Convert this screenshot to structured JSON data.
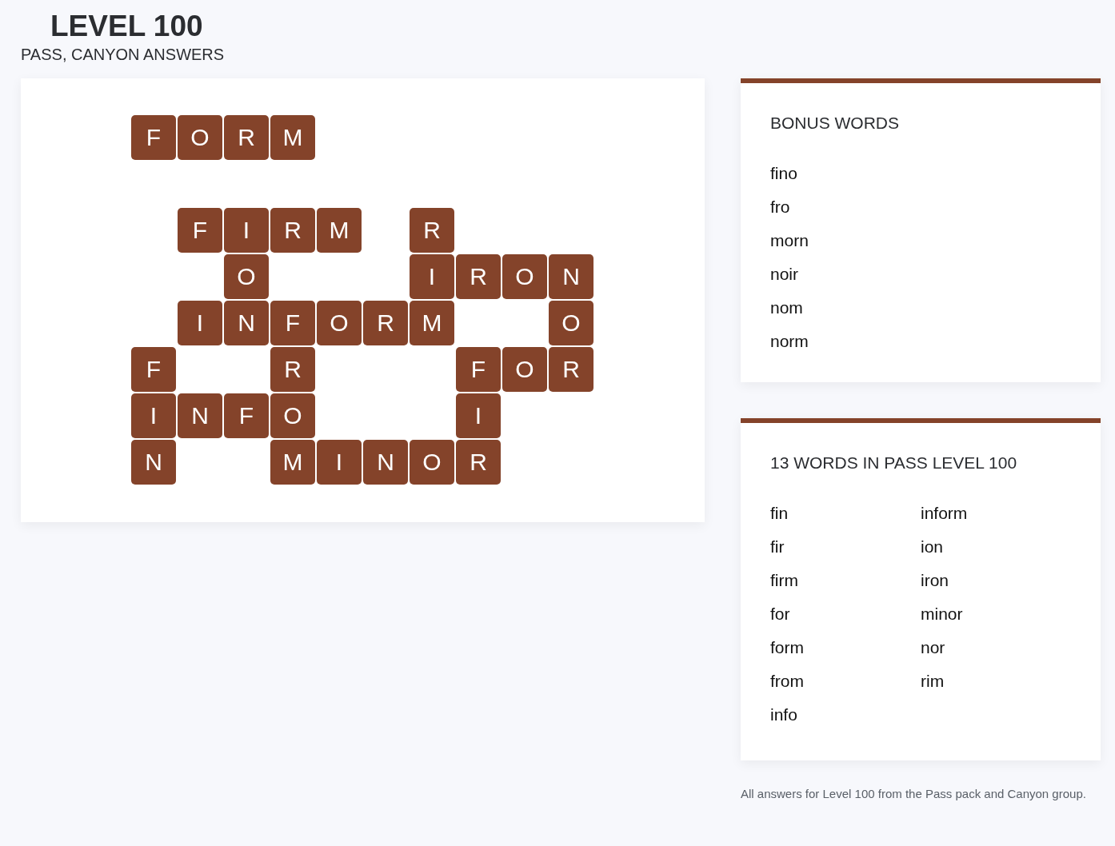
{
  "header": {
    "title": "LEVEL 100",
    "subtitle": "PASS, CANYON ANSWERS"
  },
  "board": {
    "rows": [
      [
        "F",
        "O",
        "R",
        "M",
        null,
        null,
        null,
        null,
        null,
        null
      ],
      [
        null,
        null,
        null,
        null,
        null,
        null,
        null,
        null,
        null,
        null
      ],
      [
        null,
        "F",
        "I",
        "R",
        "M",
        null,
        "R",
        null,
        null,
        null
      ],
      [
        null,
        null,
        "O",
        null,
        null,
        null,
        "I",
        "R",
        "O",
        "N"
      ],
      [
        null,
        "I",
        "N",
        "F",
        "O",
        "R",
        "M",
        null,
        null,
        "O"
      ],
      [
        "F",
        null,
        null,
        "R",
        null,
        null,
        null,
        "F",
        "O",
        "R"
      ],
      [
        "I",
        "N",
        "F",
        "O",
        null,
        null,
        null,
        "I",
        null,
        null
      ],
      [
        "N",
        null,
        null,
        "M",
        "I",
        "N",
        "O",
        "R",
        null,
        null
      ]
    ]
  },
  "bonus": {
    "title": "BONUS WORDS",
    "words": [
      "fino",
      "fro",
      "morn",
      "noir",
      "nom",
      "norm"
    ]
  },
  "answers": {
    "title": "13 WORDS IN PASS LEVEL 100",
    "columns": [
      [
        "fin",
        "fir",
        "firm",
        "for",
        "form",
        "from",
        "info"
      ],
      [
        "inform",
        "ion",
        "iron",
        "minor",
        "nor",
        "rim"
      ]
    ]
  },
  "footnote": "All answers for Level 100 from the Pass pack and Canyon group."
}
